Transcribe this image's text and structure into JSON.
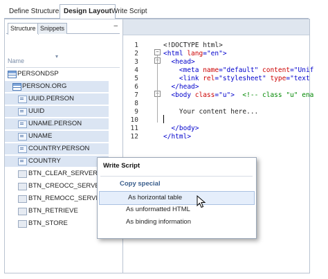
{
  "top_tabs": [
    {
      "label": "Define Structure",
      "active": false
    },
    {
      "label": "Design Layout",
      "active": true
    },
    {
      "label": "Write Script",
      "active": false
    }
  ],
  "left_panel": {
    "tabs": [
      {
        "label": "Structure",
        "active": true
      },
      {
        "label": "Snippets",
        "active": false
      }
    ],
    "pin_icon": "pin-icon",
    "column_header": "Name",
    "sort_indicator": "▾",
    "tree": [
      {
        "label": "PERSONDSP",
        "icon": "table-icon",
        "selected": false
      },
      {
        "label": "PERSON.ORG",
        "icon": "table-icon",
        "selected": true
      },
      {
        "label": "UUID.PERSON",
        "icon": "field-icon",
        "selected": true
      },
      {
        "label": "UUID",
        "icon": "field-icon",
        "selected": true
      },
      {
        "label": "UNAME.PERSON",
        "icon": "field-icon",
        "selected": true
      },
      {
        "label": "UNAME",
        "icon": "field-icon",
        "selected": true
      },
      {
        "label": "COUNTRY.PERSON",
        "icon": "field-icon",
        "selected": true
      },
      {
        "label": "COUNTRY",
        "icon": "field-icon",
        "selected": true
      },
      {
        "label": "BTN_CLEAR_SERVER",
        "icon": "button-icon",
        "selected": false
      },
      {
        "label": "BTN_CREOCC_SERVER",
        "icon": "button-icon",
        "selected": false
      },
      {
        "label": "BTN_REMOCC_SERVER",
        "icon": "button-icon",
        "selected": false
      },
      {
        "label": "BTN_RETRIEVE",
        "icon": "button-icon",
        "selected": false
      },
      {
        "label": "BTN_STORE",
        "icon": "button-icon",
        "selected": false
      }
    ]
  },
  "editor": {
    "lines": [
      {
        "n": "1",
        "parts": [
          {
            "t": "<!DOCTYPE html>",
            "c": ""
          }
        ]
      },
      {
        "n": "2",
        "parts": [
          {
            "t": "<html ",
            "c": "blue"
          },
          {
            "t": "lang",
            "c": "red"
          },
          {
            "t": "=\"en\">",
            "c": "blue"
          }
        ]
      },
      {
        "n": "3",
        "parts": [
          {
            "t": "  <head>",
            "c": "blue"
          }
        ]
      },
      {
        "n": "4",
        "parts": [
          {
            "t": "    <meta ",
            "c": "blue"
          },
          {
            "t": "name",
            "c": "red"
          },
          {
            "t": "=\"default\" ",
            "c": "blue"
          },
          {
            "t": "content",
            "c": "red"
          },
          {
            "t": "=\"Unif",
            "c": "blue"
          }
        ]
      },
      {
        "n": "5",
        "parts": [
          {
            "t": "    <link ",
            "c": "blue"
          },
          {
            "t": "rel",
            "c": "red"
          },
          {
            "t": "=\"stylesheet\" ",
            "c": "blue"
          },
          {
            "t": "type",
            "c": "red"
          },
          {
            "t": "=\"text",
            "c": "blue"
          }
        ]
      },
      {
        "n": "6",
        "parts": [
          {
            "t": "  </head>",
            "c": "blue"
          }
        ]
      },
      {
        "n": "7",
        "parts": [
          {
            "t": "  <body ",
            "c": "blue"
          },
          {
            "t": "class",
            "c": "red"
          },
          {
            "t": "=\"u\">  ",
            "c": "blue"
          },
          {
            "t": "<!-- class \"u\" ena",
            "c": "green"
          }
        ]
      },
      {
        "n": "8",
        "parts": [
          {
            "t": "",
            "c": ""
          }
        ]
      },
      {
        "n": "9",
        "parts": [
          {
            "t": "    Your content here...",
            "c": ""
          }
        ]
      },
      {
        "n": "10",
        "parts": [
          {
            "t": "",
            "c": ""
          }
        ]
      },
      {
        "n": "11",
        "parts": [
          {
            "t": "  </body>",
            "c": "blue"
          }
        ]
      },
      {
        "n": "12",
        "parts": [
          {
            "t": "</html>",
            "c": "blue"
          }
        ]
      }
    ],
    "fold_markers": [
      "minus",
      "minus",
      "minus"
    ]
  },
  "context_menu": {
    "header": "Write Script",
    "group_label": "Copy special",
    "items": [
      {
        "label": "As horizontal table",
        "highlighted": true
      },
      {
        "label": "As unformatted HTML",
        "highlighted": false
      },
      {
        "label": "As binding information",
        "highlighted": false
      }
    ]
  },
  "colors": {
    "selection": "#dbe5f3",
    "menu_highlight": "#e5eefb",
    "tag_blue": "#0000cc",
    "attr_red": "#cc0000",
    "comment_green": "#008800"
  }
}
